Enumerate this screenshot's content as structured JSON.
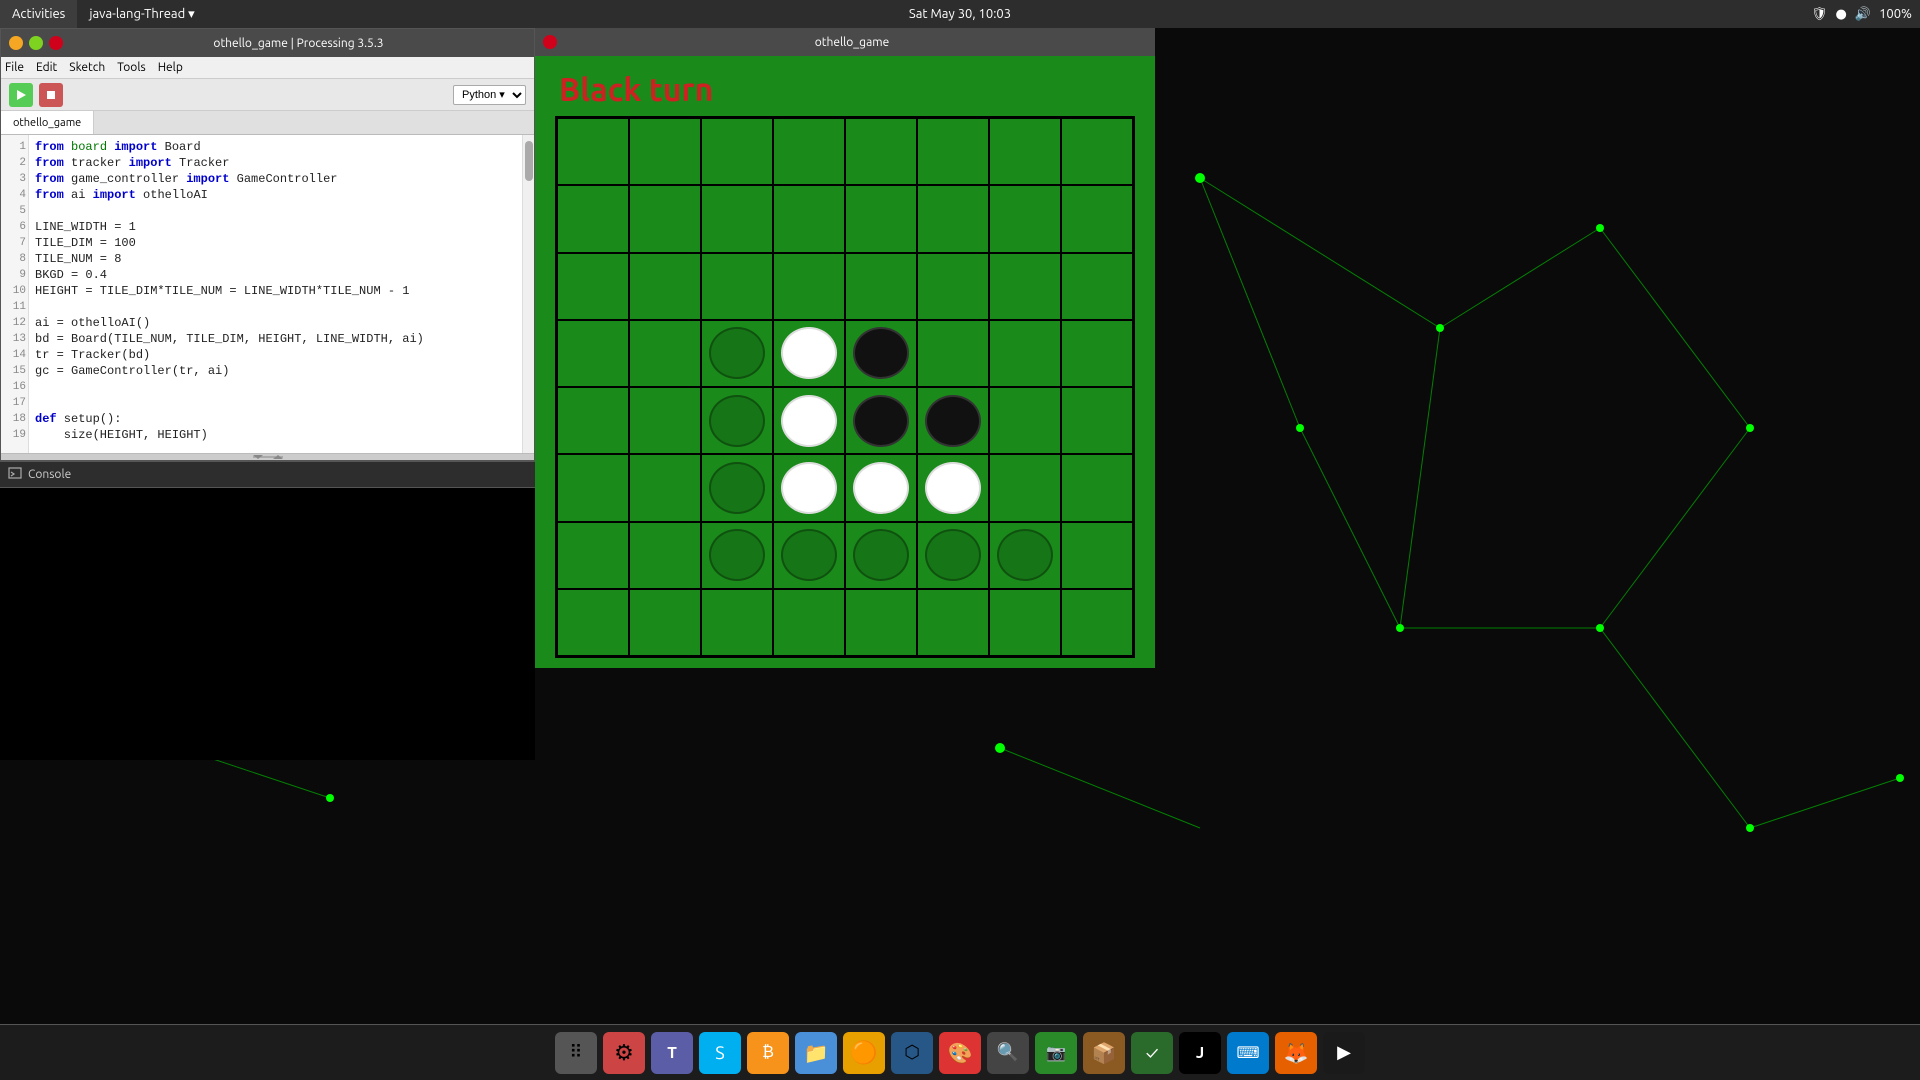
{
  "topbar": {
    "activities_label": "Activities",
    "app_indicator": "java-lang-Thread ▾",
    "clock": "Sat May 30, 10:03",
    "battery": "100%"
  },
  "ide": {
    "title": "othello_game | Processing 3.5.3",
    "tab_label": "othello_game",
    "mode_label": "Python ▾",
    "menu": {
      "file": "File",
      "edit": "Edit",
      "sketch": "Sketch",
      "tools": "Tools",
      "help": "Help"
    },
    "code_lines": [
      {
        "num": "1",
        "text": "from board import Board"
      },
      {
        "num": "2",
        "text": "from tracker import Tracker"
      },
      {
        "num": "3",
        "text": "from game_controller import GameController"
      },
      {
        "num": "4",
        "text": "from ai import othelloAI"
      },
      {
        "num": "5",
        "text": ""
      },
      {
        "num": "6",
        "text": "LINE_WIDTH = 1"
      },
      {
        "num": "7",
        "text": "TILE_DIM = 100"
      },
      {
        "num": "8",
        "text": "TILE_NUM = 8"
      },
      {
        "num": "9",
        "text": "BKGD = 0.4"
      },
      {
        "num": "10",
        "text": "HEIGHT = TILE_DIM*TILE_NUM = LINE_WIDTH*TILE_NUM - 1"
      },
      {
        "num": "11",
        "text": ""
      },
      {
        "num": "12",
        "text": "ai = othelloAI()"
      },
      {
        "num": "13",
        "text": "bd = Board(TILE_NUM, TILE_DIM, HEIGHT, LINE_WIDTH, ai)"
      },
      {
        "num": "14",
        "text": "tr = Tracker(bd)"
      },
      {
        "num": "15",
        "text": "gc = GameController(tr, ai)"
      },
      {
        "num": "16",
        "text": ""
      },
      {
        "num": "17",
        "text": ""
      },
      {
        "num": "18",
        "text": "def setup():"
      },
      {
        "num": "19",
        "text": "    size(HEIGHT, HEIGHT)"
      }
    ]
  },
  "console": {
    "label": "Console"
  },
  "game": {
    "title": "othello_game",
    "turn_label": "Black turn",
    "board": {
      "size": 8,
      "pieces": [
        {
          "row": 3,
          "col": 2,
          "type": "ghost"
        },
        {
          "row": 4,
          "col": 2,
          "type": "ghost"
        },
        {
          "row": 5,
          "col": 2,
          "type": "ghost"
        },
        {
          "row": 3,
          "col": 3,
          "type": "white"
        },
        {
          "row": 3,
          "col": 4,
          "type": "black"
        },
        {
          "row": 4,
          "col": 3,
          "type": "white"
        },
        {
          "row": 4,
          "col": 4,
          "type": "black"
        },
        {
          "row": 4,
          "col": 5,
          "type": "black"
        },
        {
          "row": 5,
          "col": 3,
          "type": "white"
        },
        {
          "row": 5,
          "col": 4,
          "type": "white"
        },
        {
          "row": 5,
          "col": 5,
          "type": "white"
        },
        {
          "row": 6,
          "col": 2,
          "type": "ghost"
        },
        {
          "row": 6,
          "col": 3,
          "type": "ghost"
        },
        {
          "row": 6,
          "col": 4,
          "type": "ghost"
        },
        {
          "row": 6,
          "col": 5,
          "type": "ghost"
        },
        {
          "row": 6,
          "col": 6,
          "type": "ghost"
        }
      ]
    }
  },
  "taskbar": {
    "icons": [
      {
        "name": "apps-grid-icon",
        "symbol": "⠿",
        "bg": "#555"
      },
      {
        "name": "settings-icon",
        "symbol": "⚙",
        "bg": "#c44"
      },
      {
        "name": "teams-icon",
        "symbol": "T",
        "bg": "#5b5ea6"
      },
      {
        "name": "skype-icon",
        "symbol": "S",
        "bg": "#00aff0"
      },
      {
        "name": "bitcoin-icon",
        "symbol": "₿",
        "bg": "#f7931a"
      },
      {
        "name": "files-icon",
        "symbol": "🗂",
        "bg": "#4a90d9"
      },
      {
        "name": "vlc-icon",
        "symbol": "▶",
        "bg": "#f90"
      },
      {
        "name": "blender-icon",
        "symbol": "⬡",
        "bg": "#ea7600"
      },
      {
        "name": "graphics-icon",
        "symbol": "🎨",
        "bg": "#c44"
      },
      {
        "name": "search-icon",
        "symbol": "🔍",
        "bg": "#888"
      },
      {
        "name": "greenshot-icon",
        "symbol": "📷",
        "bg": "#3a3"
      },
      {
        "name": "archive-icon",
        "symbol": "📦",
        "bg": "#c84"
      },
      {
        "name": "checklist-icon",
        "symbol": "✓",
        "bg": "#4a4"
      },
      {
        "name": "jetbrains-icon",
        "symbol": "J",
        "bg": "#000"
      },
      {
        "name": "vscode-icon",
        "symbol": "⌨",
        "bg": "#007acc"
      },
      {
        "name": "firefox-icon",
        "symbol": "🦊",
        "bg": "#e66000"
      },
      {
        "name": "media-icon",
        "symbol": "▶",
        "bg": "#1a1a1a"
      }
    ]
  }
}
